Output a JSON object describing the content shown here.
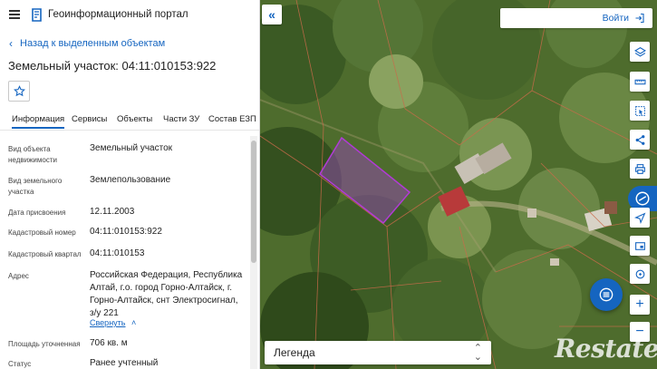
{
  "header": {
    "menu_icon": "hamburger-icon",
    "logo_icon": "portal-logo-icon",
    "title": "Геоинформационный портал"
  },
  "nav": {
    "back_label": "Назад к выделенным объектам"
  },
  "object": {
    "title": "Земельный участок: 04:11:010153:922"
  },
  "tabs": [
    {
      "label": "Информация",
      "active": true
    },
    {
      "label": "Сервисы"
    },
    {
      "label": "Объекты"
    },
    {
      "label": "Части ЗУ"
    },
    {
      "label": "Состав ЕЗП"
    }
  ],
  "attributes": [
    {
      "label": "Вид объекта недвижимости",
      "value": "Земельный участок"
    },
    {
      "label": "Вид земельного участка",
      "value": "Землепользование"
    },
    {
      "label": "Дата присвоения",
      "value": "12.11.2003"
    },
    {
      "label": "Кадастровый номер",
      "value": "04:11:010153:922"
    },
    {
      "label": "Кадастровый квартал",
      "value": "04:11:010153"
    },
    {
      "label": "Адрес",
      "value": "Российская Федерация, Республика Алтай, г.о. город Горно-Алтайск, г. Горно-Алтайск, снт Электросигнал, з/у 221"
    },
    {
      "label": "Площадь уточненная",
      "value": "706 кв. м"
    },
    {
      "label": "Статус",
      "value": "Ранее учтенный"
    }
  ],
  "address_collapse_label": "Свернуть",
  "map": {
    "login_label": "Войти",
    "legend_label": "Легенда",
    "tools": [
      "layers-icon",
      "ruler-icon",
      "select-area-icon",
      "share-icon",
      "print-icon",
      "ruler-alt-icon",
      "locate-icon",
      "screenshot-icon",
      "routes-icon",
      "zoom-in-icon",
      "zoom-out-icon"
    ]
  },
  "watermark": "Restate",
  "colors": {
    "accent": "#1565c0",
    "parcel_outline": "#b13bd6"
  }
}
